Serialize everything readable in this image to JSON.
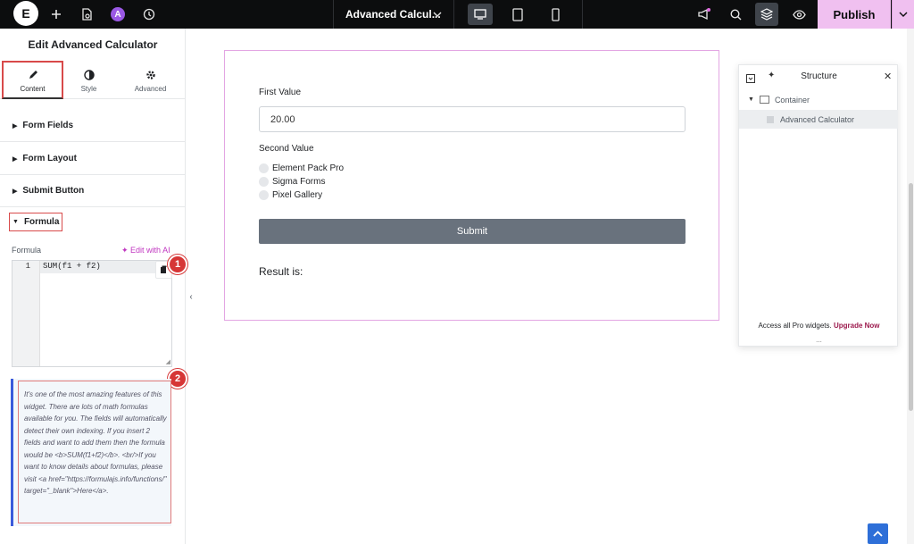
{
  "topbar": {
    "logo_text": "E",
    "ai_badge": "A",
    "page_title": "Advanced Calcul...",
    "publish_label": "Publish"
  },
  "panel": {
    "title": "Edit Advanced Calculator",
    "tabs": [
      {
        "label": "Content"
      },
      {
        "label": "Style"
      },
      {
        "label": "Advanced"
      }
    ],
    "sections": [
      {
        "label": "Form Fields"
      },
      {
        "label": "Form Layout"
      },
      {
        "label": "Submit Button"
      }
    ],
    "formula_section": "Formula",
    "formula_label": "Formula",
    "edit_with_ai": "Edit with AI",
    "editor": {
      "line_number": "1",
      "code": "SUM(f1 + f2)"
    },
    "description": "It's one of the most amazing features of this widget. There are lots of math formulas available for you. The fields will automatically detect their own indexing. If you insert 2 fields and want to add them then the formula would be <b>SUM(f1+f2)</b>. <br/>If you want to know details about formulas, please visit <a href=\"https://formulajs.info/functions/\" target=\"_blank\">Here</a>.",
    "badges": [
      "1",
      "2"
    ]
  },
  "form": {
    "first_label": "First Value",
    "first_value": "20.00",
    "second_label": "Second Value",
    "options": [
      "Element Pack Pro",
      "Sigma Forms",
      "Pixel Gallery"
    ],
    "submit_label": "Submit",
    "result_label": "Result is:"
  },
  "structure": {
    "title": "Structure",
    "items": [
      {
        "label": "Container"
      },
      {
        "label": "Advanced Calculator"
      }
    ],
    "footer_text": "Access all Pro widgets.",
    "footer_link": "Upgrade Now",
    "grip": "..."
  },
  "colors": {
    "publish_bg": "#f0c0f0",
    "highlight_red": "#d84a4a",
    "canvas_border": "#e3a6e3",
    "submit_bg": "#69727d",
    "upgrade_link": "#9c1a4d"
  }
}
